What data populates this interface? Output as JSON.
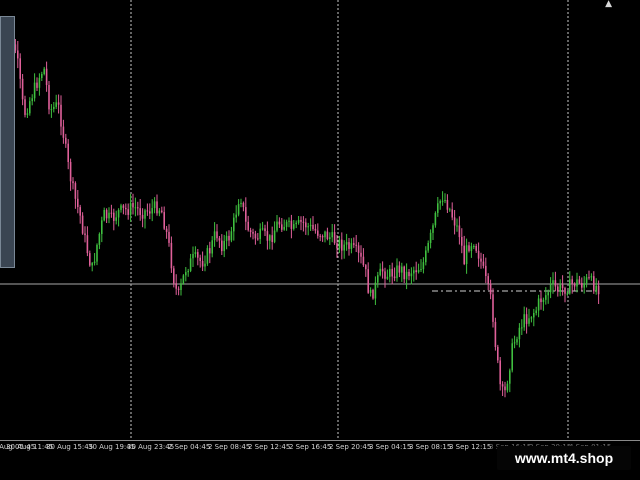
{
  "chart": {
    "symbol": "",
    "colors": {
      "background": "#000000",
      "bull_candle": "#3fbf3f",
      "bear_candle": "#e0609a",
      "grid": "#c8c8c8",
      "level_line": "#a9a9a9",
      "axis_text": "#d0d0d0"
    }
  },
  "time_axis": {
    "labels": [
      {
        "text": "29 Aug 05:45",
        "dim": false
      },
      {
        "text": "30 Aug 11:45",
        "dim": false
      },
      {
        "text": "30 Aug 15:45",
        "dim": false
      },
      {
        "text": "30 Aug 19:45",
        "dim": false
      },
      {
        "text": "30 Aug 23:45",
        "dim": false
      },
      {
        "text": "2 Sep 04:45",
        "dim": false
      },
      {
        "text": "2 Sep 08:45",
        "dim": false
      },
      {
        "text": "2 Sep 12:45",
        "dim": false
      },
      {
        "text": "2 Sep 16:45",
        "dim": false
      },
      {
        "text": "2 Sep 20:45",
        "dim": false
      },
      {
        "text": "3 Sep 04:15",
        "dim": false
      },
      {
        "text": "3 Sep 08:15",
        "dim": false
      },
      {
        "text": "3 Sep 12:15",
        "dim": false
      },
      {
        "text": "3 Sep 16:15",
        "dim": true
      },
      {
        "text": "3 Sep 20:15",
        "dim": true
      },
      {
        "text": "4 Sep 01:15",
        "dim": true
      }
    ]
  },
  "watermark": {
    "text": "www.mt4.shop"
  },
  "icons": {
    "scroll_arrow": "chart-shift-arrow-icon"
  }
}
